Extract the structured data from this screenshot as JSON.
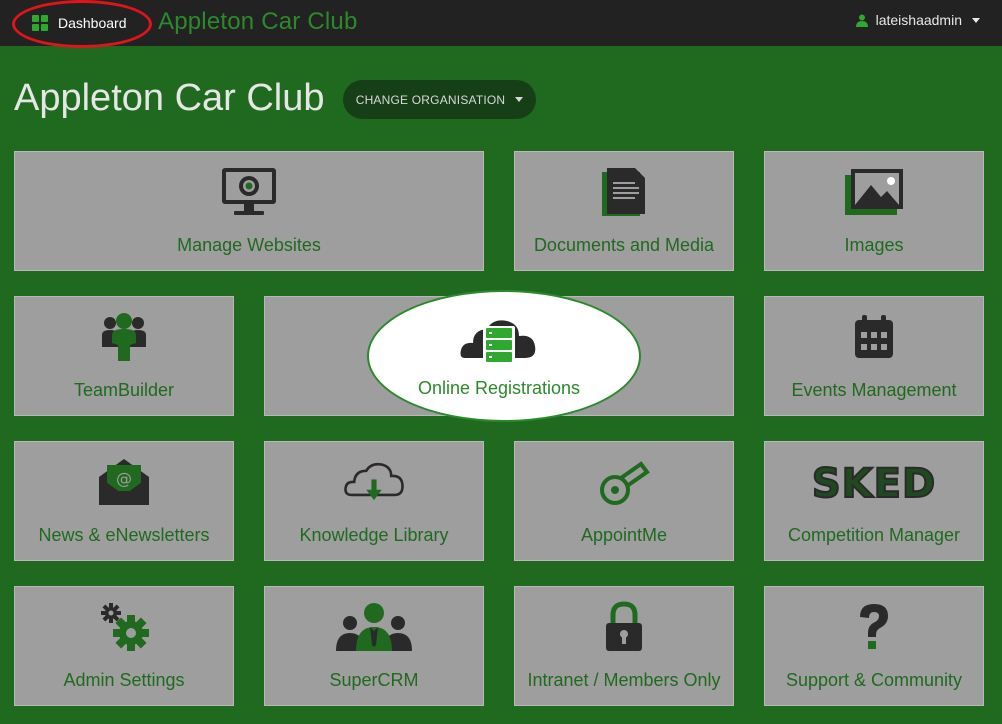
{
  "topbar": {
    "dashboard_label": "Dashboard",
    "brand": "Appleton Car Club",
    "username": "lateishaadmin"
  },
  "header": {
    "title": "Appleton Car Club",
    "change_org_label": "CHANGE ORGANISATION"
  },
  "tiles": {
    "manage_websites": "Manage Websites",
    "documents_media": "Documents and Media",
    "images": "Images",
    "teambuilder": "TeamBuilder",
    "online_registrations": "Online Registrations",
    "events_management": "Events Management",
    "news": "News & eNewsletters",
    "knowledge_library": "Knowledge Library",
    "appointme": "AppointMe",
    "competition_manager": "Competition Manager",
    "competition_logo": "SKED",
    "admin_settings": "Admin Settings",
    "supercrm": "SuperCRM",
    "intranet": "Intranet / Members Only",
    "support": "Support & Community"
  },
  "colors": {
    "background": "#1f6a1f",
    "topbar": "#222222",
    "tile": "#9e9e9e",
    "accent_green": "#2b8a2b",
    "highlight_ring": "#e0141b"
  },
  "icons": {
    "dashboard": "grid-icon",
    "user": "user-icon",
    "manage_websites": "monitor-icon",
    "documents_media": "document-icon",
    "images": "image-icon",
    "teambuilder": "team-icon",
    "online_registrations": "cloud-server-icon",
    "events_management": "calendar-icon",
    "news": "envelope-at-icon",
    "knowledge_library": "cloud-download-icon",
    "appointme": "whistle-icon",
    "admin_settings": "gears-icon",
    "supercrm": "people-icon",
    "intranet": "padlock-icon",
    "support": "question-icon"
  }
}
